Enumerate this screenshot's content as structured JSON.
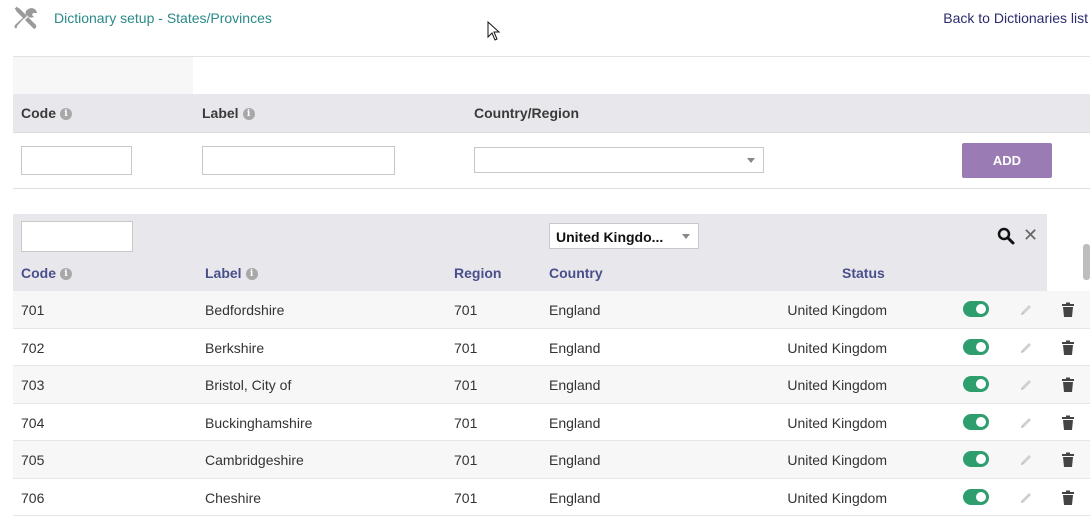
{
  "header": {
    "title": "Dictionary setup - States/Provinces",
    "back_link": "Back to Dictionaries list",
    "icon": "tools-icon"
  },
  "add_form": {
    "code_label": "Code",
    "label_label": "Label",
    "country_label": "Country/Region",
    "info_glyph": "i",
    "code_value": "",
    "label_value": "",
    "country_value": "",
    "add_button": "ADD"
  },
  "list": {
    "code_filter_value": "",
    "country_filter": "United Kingdo...",
    "columns": {
      "code": "Code",
      "label": "Label",
      "region": "Region",
      "country": "Country",
      "status": "Status"
    },
    "rows": [
      {
        "code": "701",
        "label": "Bedfordshire",
        "region": "701",
        "country": "England",
        "status": "United Kingdom",
        "enabled": true
      },
      {
        "code": "702",
        "label": "Berkshire",
        "region": "701",
        "country": "England",
        "status": "United Kingdom",
        "enabled": true
      },
      {
        "code": "703",
        "label": "Bristol, City of",
        "region": "701",
        "country": "England",
        "status": "United Kingdom",
        "enabled": true
      },
      {
        "code": "704",
        "label": "Buckinghamshire",
        "region": "701",
        "country": "England",
        "status": "United Kingdom",
        "enabled": true
      },
      {
        "code": "705",
        "label": "Cambridgeshire",
        "region": "701",
        "country": "England",
        "status": "United Kingdom",
        "enabled": true
      },
      {
        "code": "706",
        "label": "Cheshire",
        "region": "701",
        "country": "England",
        "status": "United Kingdom",
        "enabled": true
      }
    ]
  },
  "colors": {
    "title": "#2a8a8a",
    "add_button": "#9b7bb3",
    "toggle_on": "#2e9e6e",
    "column_header": "#4a4f8c"
  }
}
